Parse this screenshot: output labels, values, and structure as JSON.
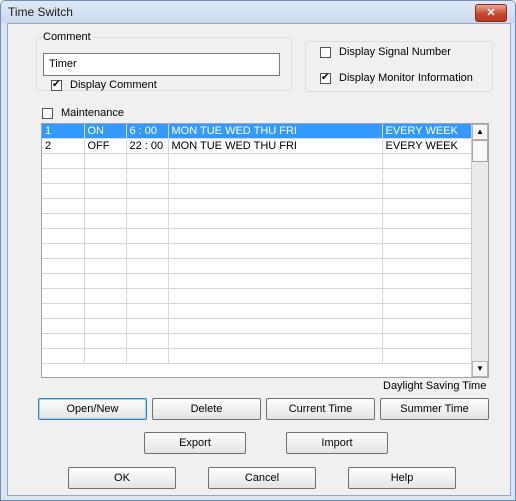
{
  "window": {
    "title": "Time Switch",
    "close_symbol": "✕"
  },
  "comment_group": {
    "legend": "Comment",
    "value": "Timer",
    "display_comment_label": "Display Comment",
    "display_comment_checked": true
  },
  "display_group": {
    "signal_number_label": "Display Signal Number",
    "signal_number_checked": false,
    "monitor_info_label": "Display Monitor Information",
    "monitor_info_checked": true
  },
  "maintenance": {
    "label": "Maintenance",
    "checked": false
  },
  "schedule": {
    "rows": [
      {
        "no": "1",
        "state": "ON",
        "time": "6 : 00",
        "days": "MON TUE WED THU FRI",
        "repeat": "EVERY WEEK",
        "selected": true
      },
      {
        "no": "2",
        "state": "OFF",
        "time": "22 : 00",
        "days": "MON TUE WED THU FRI",
        "repeat": "EVERY WEEK",
        "selected": false
      }
    ],
    "empty_rows": 14
  },
  "daylight_saving_label": "Daylight Saving Time",
  "buttons": {
    "open_new": "Open/New",
    "delete": "Delete",
    "current_time": "Current Time",
    "summer_time": "Summer Time",
    "export": "Export",
    "import": "Import",
    "ok": "OK",
    "cancel": "Cancel",
    "help": "Help"
  },
  "scroll_icons": {
    "up": "▲",
    "down": "▼"
  }
}
